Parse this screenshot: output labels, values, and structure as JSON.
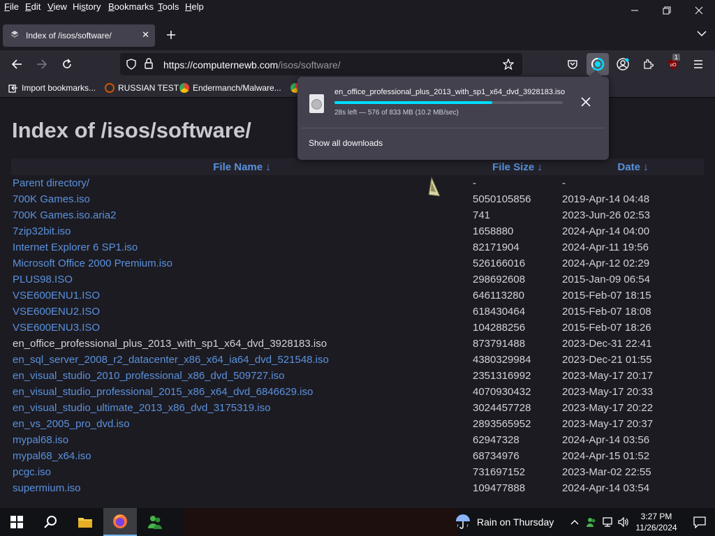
{
  "menubar": {
    "items": [
      {
        "pre": "",
        "key": "F",
        "post": "ile"
      },
      {
        "pre": "",
        "key": "E",
        "post": "dit"
      },
      {
        "pre": "",
        "key": "V",
        "post": "iew"
      },
      {
        "pre": "Hi",
        "key": "s",
        "post": "tory"
      },
      {
        "pre": "",
        "key": "B",
        "post": "ookmarks"
      },
      {
        "pre": "",
        "key": "T",
        "post": "ools"
      },
      {
        "pre": "",
        "key": "H",
        "post": "elp"
      }
    ]
  },
  "tab": {
    "title": "Index of /isos/software/"
  },
  "urlbar": {
    "url_host": "https://computernewb.com",
    "url_path": "/isos/software/"
  },
  "extension_badge": "1",
  "bookmarks": [
    {
      "label": "Import bookmarks...",
      "icon": "import-icon"
    },
    {
      "label": "RUSSIAN TEST",
      "icon": "favicon"
    },
    {
      "label": "Endermanch/Malware...",
      "icon": "github-icon"
    }
  ],
  "page": {
    "title": "Index of /isos/software/",
    "headers": {
      "name": "File Name  ↓",
      "size": "File Size  ↓",
      "date": "Date  ↓"
    },
    "rows": [
      {
        "name": "Parent directory/",
        "size": "-",
        "date": "-",
        "link": true
      },
      {
        "name": "700K Games.iso",
        "size": "5050105856",
        "date": "2019-Apr-14 04:48",
        "link": true
      },
      {
        "name": "700K Games.iso.aria2",
        "size": "741",
        "date": "2023-Jun-26 02:53",
        "link": true
      },
      {
        "name": "7zip32bit.iso",
        "size": "1658880",
        "date": "2024-Apr-14 04:00",
        "link": true
      },
      {
        "name": "Internet Explorer 6 SP1.iso",
        "size": "82171904",
        "date": "2024-Apr-11 19:56",
        "link": true
      },
      {
        "name": "Microsoft Office 2000 Premium.iso",
        "size": "526166016",
        "date": "2024-Apr-12 02:29",
        "link": true
      },
      {
        "name": "PLUS98.ISO",
        "size": "298692608",
        "date": "2015-Jan-09 06:54",
        "link": true
      },
      {
        "name": "VSE600ENU1.ISO",
        "size": "646113280",
        "date": "2015-Feb-07 18:15",
        "link": true
      },
      {
        "name": "VSE600ENU2.ISO",
        "size": "618430464",
        "date": "2015-Feb-07 18:08",
        "link": true
      },
      {
        "name": "VSE600ENU3.ISO",
        "size": "104288256",
        "date": "2015-Feb-07 18:26",
        "link": true
      },
      {
        "name": "en_office_professional_plus_2013_with_sp1_x64_dvd_3928183.iso",
        "size": "873791488",
        "date": "2023-Dec-31 22:41",
        "link": false
      },
      {
        "name": "en_sql_server_2008_r2_datacenter_x86_x64_ia64_dvd_521548.iso",
        "size": "4380329984",
        "date": "2023-Dec-21 01:55",
        "link": true
      },
      {
        "name": "en_visual_studio_2010_professional_x86_dvd_509727.iso",
        "size": "2351316992",
        "date": "2023-May-17 20:17",
        "link": true
      },
      {
        "name": "en_visual_studio_professional_2015_x86_x64_dvd_6846629.iso",
        "size": "4070930432",
        "date": "2023-May-17 20:33",
        "link": true
      },
      {
        "name": "en_visual_studio_ultimate_2013_x86_dvd_3175319.iso",
        "size": "3024457728",
        "date": "2023-May-17 20:22",
        "link": true
      },
      {
        "name": "en_vs_2005_pro_dvd.iso",
        "size": "2893565952",
        "date": "2023-May-17 20:37",
        "link": true
      },
      {
        "name": "mypal68.iso",
        "size": "62947328",
        "date": "2024-Apr-14 03:56",
        "link": true
      },
      {
        "name": "mypal68_x64.iso",
        "size": "68734976",
        "date": "2024-Apr-15 01:52",
        "link": true
      },
      {
        "name": "pcgc.iso",
        "size": "731697152",
        "date": "2023-Mar-02 22:55",
        "link": true
      },
      {
        "name": "supermium.iso",
        "size": "109477888",
        "date": "2024-Apr-14 03:54",
        "link": true
      }
    ]
  },
  "download": {
    "filename": "en_office_professional_plus_2013_with_sp1_x64_dvd_3928183.iso",
    "status": "28s left — 576 of 833 MB (10.2 MB/sec)",
    "progress_fraction": 0.69,
    "show_all": "Show all downloads"
  },
  "taskbar": {
    "weather": "Rain on Thursday",
    "time": "3:27 PM",
    "date": "11/26/2024"
  }
}
